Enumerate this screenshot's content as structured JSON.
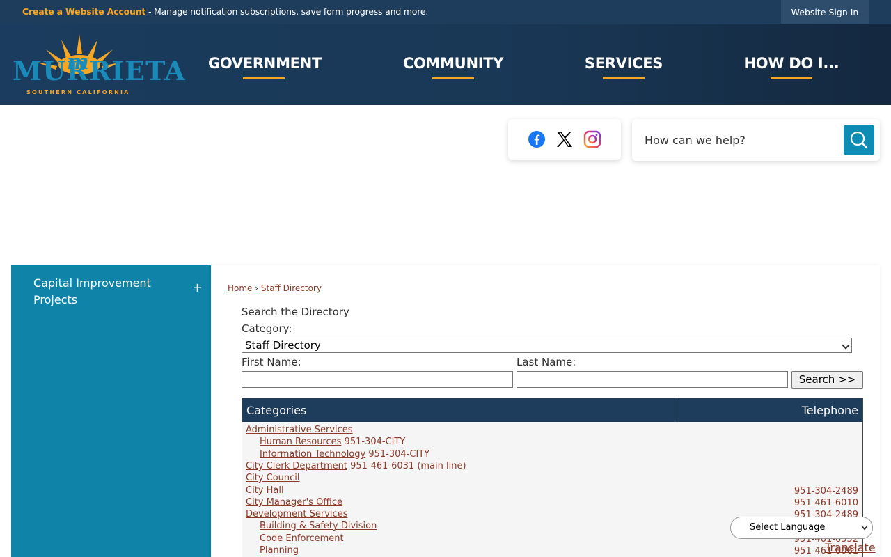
{
  "topbar": {
    "account_link": "Create a Website Account",
    "account_desc": " - Manage notification subscriptions, save form progress and more.",
    "signin": "Website Sign In"
  },
  "logo": {
    "word": "MURRIETA",
    "sub": "SOUTHERN CALIFORNIA"
  },
  "nav": [
    "GOVERNMENT",
    "COMMUNITY",
    "SERVICES",
    "HOW DO I..."
  ],
  "social": {
    "icons": [
      "facebook-icon",
      "x-icon",
      "instagram-icon"
    ]
  },
  "search": {
    "placeholder": "How can we help?"
  },
  "sidebar": {
    "items": [
      {
        "label": "Capital Improvement Projects",
        "toggle": "+"
      }
    ]
  },
  "breadcrumb": {
    "home": "Home",
    "sep": "›",
    "current": "Staff Directory"
  },
  "directory": {
    "heading": "Search the Directory",
    "category_label": "Category:",
    "category_value": "Staff Directory",
    "first_name_label": "First Name:",
    "last_name_label": "Last Name:",
    "search_button": "Search >>"
  },
  "table": {
    "headers": [
      "Categories",
      "Telephone"
    ],
    "rows": [
      {
        "name": "Administrative Services",
        "inline_phone": "",
        "phone": "",
        "indent": 0
      },
      {
        "name": "Human Resources",
        "inline_phone": "951-304-CITY",
        "phone": "",
        "indent": 1
      },
      {
        "name": "Information Technology",
        "inline_phone": "951-304-CITY",
        "phone": "",
        "indent": 1
      },
      {
        "name": "City Clerk Department",
        "inline_phone": "951-461-6031 (main line)",
        "phone": "",
        "indent": 0
      },
      {
        "name": "City Council",
        "inline_phone": "",
        "phone": "",
        "indent": 0
      },
      {
        "name": "City Hall",
        "inline_phone": "",
        "phone": "951-304-2489",
        "indent": 0
      },
      {
        "name": "City Manager's Office",
        "inline_phone": "",
        "phone": "951-461-6010",
        "indent": 0
      },
      {
        "name": "Development Services",
        "inline_phone": "",
        "phone": "951-304-2489",
        "indent": 0
      },
      {
        "name": "Building & Safety Division",
        "inline_phone": "",
        "phone": "",
        "indent": 1
      },
      {
        "name": "Code Enforcement",
        "inline_phone": "",
        "phone": "951-461-6352",
        "indent": 1
      },
      {
        "name": "Planning",
        "inline_phone": "",
        "phone": "951-461-6061",
        "indent": 1
      }
    ]
  },
  "language": {
    "select": "Select Language",
    "translate": "Translate"
  },
  "colors": {
    "navy": "#1e3d5c",
    "teal": "#0f84a8",
    "gold": "#f5a623",
    "link": "#8b3a2a"
  }
}
